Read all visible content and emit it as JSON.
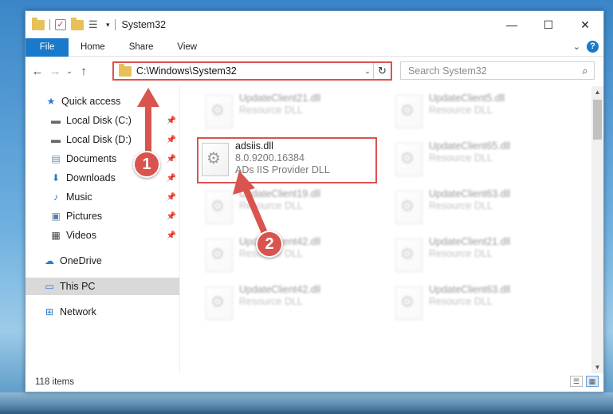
{
  "window": {
    "title": "System32",
    "controls": {
      "minimize": "—",
      "maximize": "☐",
      "close": "✕"
    }
  },
  "ribbon": {
    "file_tab": "File",
    "tabs": [
      "Home",
      "Share",
      "View"
    ],
    "help": "?",
    "expand": "⌄"
  },
  "navigation": {
    "back": "←",
    "forward": "→",
    "recent": "⌄",
    "up": "↑",
    "address": "C:\\Windows\\System32",
    "address_dropdown": "⌄",
    "refresh": "↻",
    "search_placeholder": "Search System32",
    "search_icon": "⌕"
  },
  "sidebar": {
    "items": [
      {
        "label": "Quick access",
        "icon": "star-icon",
        "glyph": "★",
        "pinned": false
      },
      {
        "label": "Local Disk (C:)",
        "icon": "drive-icon",
        "glyph": "▬",
        "pinned": true
      },
      {
        "label": "Local Disk (D:)",
        "icon": "drive-icon",
        "glyph": "▬",
        "pinned": true
      },
      {
        "label": "Documents",
        "icon": "documents-icon",
        "glyph": "▤",
        "pinned": true
      },
      {
        "label": "Downloads",
        "icon": "downloads-icon",
        "glyph": "⬇",
        "pinned": true
      },
      {
        "label": "Music",
        "icon": "music-icon",
        "glyph": "♪",
        "pinned": true
      },
      {
        "label": "Pictures",
        "icon": "pictures-icon",
        "glyph": "▣",
        "pinned": true
      },
      {
        "label": "Videos",
        "icon": "videos-icon",
        "glyph": "▦",
        "pinned": true
      },
      {
        "label": "OneDrive",
        "icon": "cloud-icon",
        "glyph": "☁",
        "pinned": false
      },
      {
        "label": "This PC",
        "icon": "computer-icon",
        "glyph": "▭",
        "pinned": false,
        "selected": true
      },
      {
        "label": "Network",
        "icon": "network-icon",
        "glyph": "⊞",
        "pinned": false
      }
    ],
    "pin_glyph": "📌"
  },
  "files": {
    "left_column": [
      {
        "name": "UpdateClient21.dll",
        "type": "Resource DLL",
        "blurred": true
      },
      {
        "name": "adsiis.dll",
        "version": "8.0.9200.16384",
        "type": "ADs IIS Provider DLL",
        "blurred": false,
        "highlighted": true
      },
      {
        "name": "UpdateClient19.dll",
        "type": "Resource DLL",
        "blurred": true
      },
      {
        "name": "UpdateClient42.dll",
        "type": "Resource DLL",
        "blurred": true
      },
      {
        "name": "UpdateClient42.dll",
        "type": "Resource DLL",
        "blurred": true
      }
    ],
    "right_column": [
      {
        "name": "UpdateClient5.dll",
        "type": "Resource DLL",
        "blurred": true
      },
      {
        "name": "UpdateClient65.dll",
        "type": "Resource DLL",
        "blurred": true
      },
      {
        "name": "UpdateClient63.dll",
        "type": "Resource DLL",
        "blurred": true
      },
      {
        "name": "UpdateClient21.dll",
        "type": "Resource DLL",
        "blurred": true
      },
      {
        "name": "UpdateClient63.dll",
        "type": "Resource DLL",
        "blurred": true
      }
    ]
  },
  "status": {
    "item_count": "118 items"
  },
  "annotations": {
    "step1": "1",
    "step2": "2",
    "color": "#d9534f"
  }
}
